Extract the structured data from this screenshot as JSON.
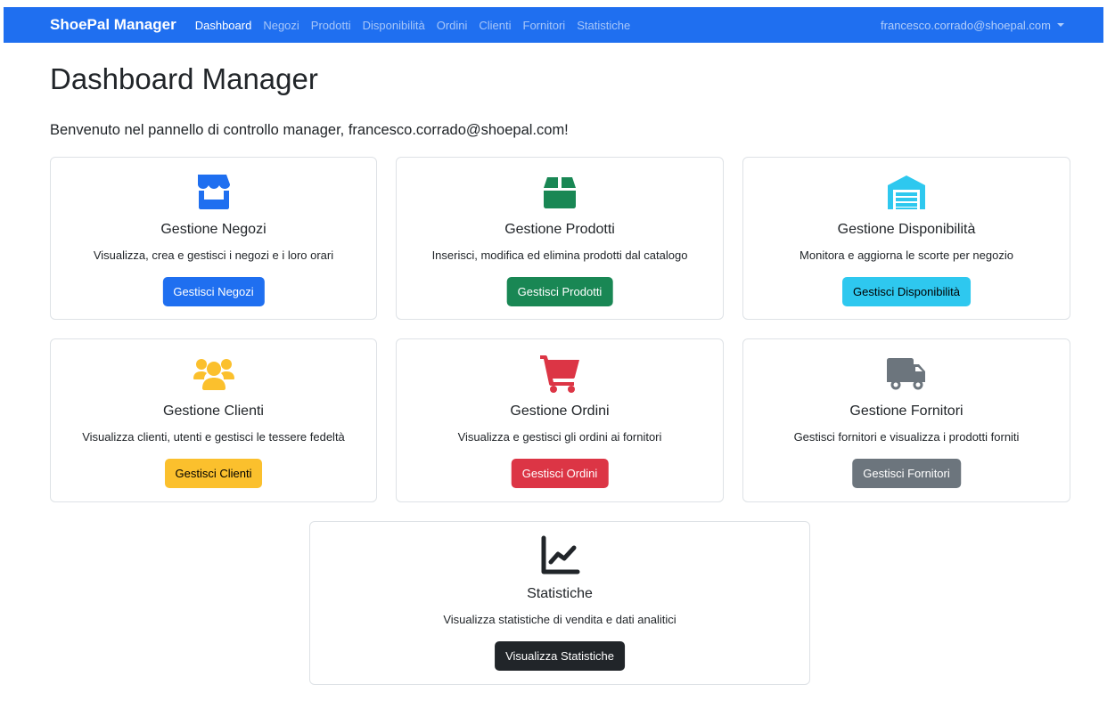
{
  "navbar": {
    "brand": "ShoePal Manager",
    "links": [
      "Dashboard",
      "Negozi",
      "Prodotti",
      "Disponibilità",
      "Ordini",
      "Clienti",
      "Fornitori",
      "Statistiche"
    ],
    "active": "Dashboard",
    "user": "francesco.corrado@shoepal.com",
    "color": "#1f6ff0"
  },
  "page": {
    "title": "Dashboard Manager",
    "welcome": "Benvenuto nel pannello di controllo manager, francesco.corrado@shoepal.com!"
  },
  "cards": [
    {
      "title": "Gestione Negozi",
      "description": "Visualizza, crea e gestisci i negozi e i loro orari",
      "button": "Gestisci Negozi",
      "icon": "store-icon",
      "color": "#1f6ff0",
      "button_text_color": "#ffffff"
    },
    {
      "title": "Gestione Prodotti",
      "description": "Inserisci, modifica ed elimina prodotti dal catalogo",
      "button": "Gestisci Prodotti",
      "icon": "box-icon",
      "color": "#198754",
      "button_text_color": "#ffffff"
    },
    {
      "title": "Gestione Disponibilità",
      "description": "Monitora e aggiorna le scorte per negozio",
      "button": "Gestisci Disponibilità",
      "icon": "warehouse-icon",
      "color": "#2ec8ef",
      "button_text_color": "#000000"
    },
    {
      "title": "Gestione Clienti",
      "description": "Visualizza clienti, utenti e gestisci le tessere fedeltà",
      "button": "Gestisci Clienti",
      "icon": "users-icon",
      "color": "#fbc02d",
      "button_text_color": "#000000"
    },
    {
      "title": "Gestione Ordini",
      "description": "Visualizza e gestisci gli ordini ai fornitori",
      "button": "Gestisci Ordini",
      "icon": "shopping-cart-icon",
      "color": "#dc3545",
      "button_text_color": "#ffffff"
    },
    {
      "title": "Gestione Fornitori",
      "description": "Gestisci fornitori e visualizza i prodotti forniti",
      "button": "Gestisci Fornitori",
      "icon": "truck-icon",
      "color": "#6c757d",
      "button_text_color": "#ffffff"
    },
    {
      "title": "Statistiche",
      "description": "Visualizza statistiche di vendita e dati analitici",
      "button": "Visualizza Statistiche",
      "icon": "chart-line-icon",
      "color": "#212529",
      "button_text_color": "#ffffff"
    }
  ]
}
